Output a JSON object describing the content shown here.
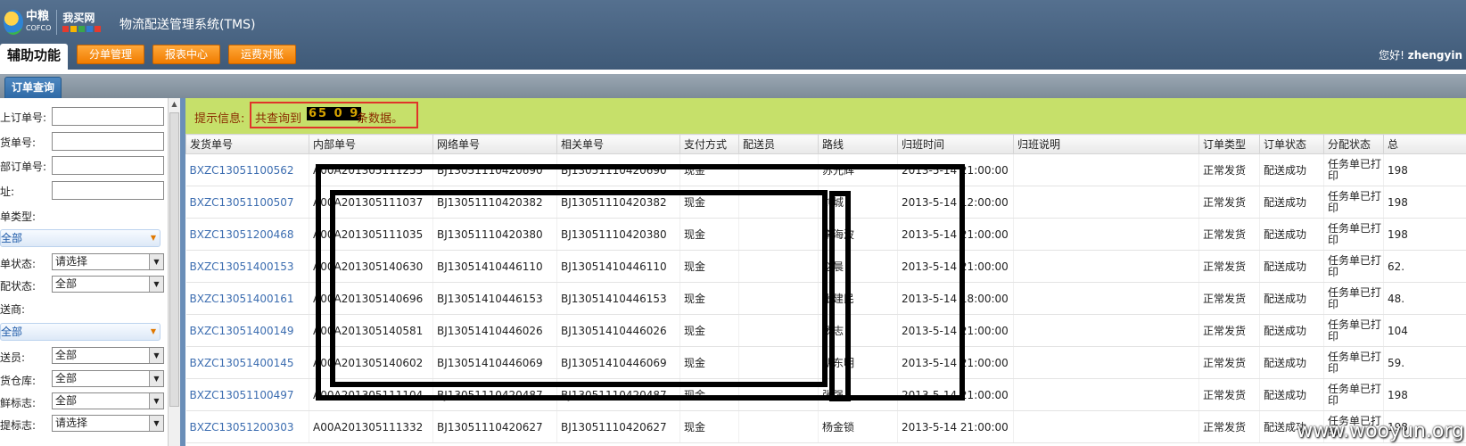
{
  "header": {
    "brand": "中粮",
    "brand_sub": "COFCO",
    "logo2": "我买网",
    "system_title": "物流配送管理系统(TMS)",
    "main_tab": "辅助功能",
    "menu": [
      "分单管理",
      "报表中心",
      "运费对账"
    ],
    "greeting": "您好!",
    "username": "zhengyin"
  },
  "subtab": "订单查询",
  "search": {
    "fields": [
      {
        "label": "上订单号:",
        "type": "input"
      },
      {
        "label": "货单号:",
        "type": "input"
      },
      {
        "label": "部订单号:",
        "type": "input"
      },
      {
        "label": "址:",
        "type": "input"
      },
      {
        "label": "单类型:",
        "type": "label"
      },
      {
        "label": "全部",
        "type": "combo"
      },
      {
        "label": "单状态:",
        "type": "select",
        "value": "请选择"
      },
      {
        "label": "配状态:",
        "type": "select",
        "value": "全部"
      },
      {
        "label": "送商:",
        "type": "label"
      },
      {
        "label": "全部",
        "type": "combo"
      },
      {
        "label": "送员:",
        "type": "select",
        "value": "全部"
      },
      {
        "label": "货仓库:",
        "type": "select",
        "value": "全部"
      },
      {
        "label": "鲜标志:",
        "type": "select",
        "value": "全部"
      },
      {
        "label": "提标志:",
        "type": "select",
        "value": "请选择"
      }
    ]
  },
  "tip": {
    "label": "提示信息:",
    "text": "共查询到",
    "count": "65 0 9",
    "tail": "条数据。"
  },
  "table": {
    "columns": [
      "发货单号",
      "内部单号",
      "网络单号",
      "相关单号",
      "支付方式",
      "配送员",
      "路线",
      "归班时间",
      "归班说明",
      "订单类型",
      "订单状态",
      "分配状态",
      "总"
    ],
    "rows": [
      [
        "BXZC13051100562",
        "A00A201305111255",
        "BJ13051110420690",
        "BJ13051110420690",
        "现金",
        "",
        "苏光辉",
        "2013-5-14 21:00:00",
        "",
        "正常发货",
        "配送成功",
        "任务单已打印",
        "198"
      ],
      [
        "BXZC13051100507",
        "A00A201305111037",
        "BJ13051110420382",
        "BJ13051110420382",
        "现金",
        "",
        "刘城",
        "2013-5-14 12:00:00",
        "",
        "正常发货",
        "配送成功",
        "任务单已打印",
        "198"
      ],
      [
        "BXZC13051200468",
        "A00A201305111035",
        "BJ13051110420380",
        "BJ13051110420380",
        "现金",
        "",
        "李海波",
        "2013-5-14 21:00:00",
        "",
        "正常发货",
        "配送成功",
        "任务单已打印",
        "198"
      ],
      [
        "BXZC13051400153",
        "A00A201305140630",
        "BJ13051410446110",
        "BJ13051410446110",
        "现金",
        "",
        "赵晨",
        "2013-5-14 21:00:00",
        "",
        "正常发货",
        "配送成功",
        "任务单已打印",
        "62."
      ],
      [
        "BXZC13051400161",
        "A00A201305140696",
        "BJ13051410446153",
        "BJ13051410446153",
        "现金",
        "",
        "张建民",
        "2013-5-14 18:00:00",
        "",
        "正常发货",
        "配送成功",
        "任务单已打印",
        "48."
      ],
      [
        "BXZC13051400149",
        "A00A201305140581",
        "BJ13051410446026",
        "BJ13051410446026",
        "现金",
        "",
        "杨志",
        "2013-5-14 21:00:00",
        "",
        "正常发货",
        "配送成功",
        "任务单已打印",
        "104"
      ],
      [
        "BXZC13051400145",
        "A00A201305140602",
        "BJ13051410446069",
        "BJ13051410446069",
        "现金",
        "",
        "胡东明",
        "2013-5-14 21:00:00",
        "",
        "正常发货",
        "配送成功",
        "任务单已打印",
        "59."
      ],
      [
        "BXZC13051100497",
        "A00A201305111104",
        "BJ13051110420487",
        "BJ13051110420487",
        "现金",
        "",
        "张强",
        "2013-5-14 21:00:00",
        "",
        "正常发货",
        "配送成功",
        "任务单已打印",
        "198"
      ],
      [
        "BXZC13051200303",
        "A00A201305111332",
        "BJ13051110420627",
        "BJ13051110420627",
        "现金",
        "",
        "杨金锁",
        "2013-5-14 21:00:00",
        "",
        "正常发货",
        "配送成功",
        "任务单已打印",
        "198"
      ]
    ]
  },
  "watermark": "www.wooyun.org"
}
